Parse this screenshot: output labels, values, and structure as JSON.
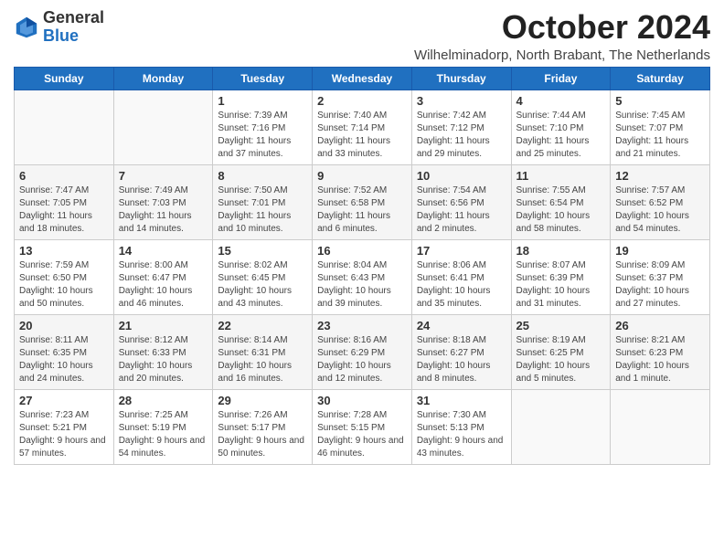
{
  "header": {
    "logo_general": "General",
    "logo_blue": "Blue",
    "month": "October 2024",
    "location": "Wilhelminadorp, North Brabant, The Netherlands"
  },
  "days_of_week": [
    "Sunday",
    "Monday",
    "Tuesday",
    "Wednesday",
    "Thursday",
    "Friday",
    "Saturday"
  ],
  "weeks": [
    [
      {
        "num": "",
        "info": ""
      },
      {
        "num": "",
        "info": ""
      },
      {
        "num": "1",
        "info": "Sunrise: 7:39 AM\nSunset: 7:16 PM\nDaylight: 11 hours and 37 minutes."
      },
      {
        "num": "2",
        "info": "Sunrise: 7:40 AM\nSunset: 7:14 PM\nDaylight: 11 hours and 33 minutes."
      },
      {
        "num": "3",
        "info": "Sunrise: 7:42 AM\nSunset: 7:12 PM\nDaylight: 11 hours and 29 minutes."
      },
      {
        "num": "4",
        "info": "Sunrise: 7:44 AM\nSunset: 7:10 PM\nDaylight: 11 hours and 25 minutes."
      },
      {
        "num": "5",
        "info": "Sunrise: 7:45 AM\nSunset: 7:07 PM\nDaylight: 11 hours and 21 minutes."
      }
    ],
    [
      {
        "num": "6",
        "info": "Sunrise: 7:47 AM\nSunset: 7:05 PM\nDaylight: 11 hours and 18 minutes."
      },
      {
        "num": "7",
        "info": "Sunrise: 7:49 AM\nSunset: 7:03 PM\nDaylight: 11 hours and 14 minutes."
      },
      {
        "num": "8",
        "info": "Sunrise: 7:50 AM\nSunset: 7:01 PM\nDaylight: 11 hours and 10 minutes."
      },
      {
        "num": "9",
        "info": "Sunrise: 7:52 AM\nSunset: 6:58 PM\nDaylight: 11 hours and 6 minutes."
      },
      {
        "num": "10",
        "info": "Sunrise: 7:54 AM\nSunset: 6:56 PM\nDaylight: 11 hours and 2 minutes."
      },
      {
        "num": "11",
        "info": "Sunrise: 7:55 AM\nSunset: 6:54 PM\nDaylight: 10 hours and 58 minutes."
      },
      {
        "num": "12",
        "info": "Sunrise: 7:57 AM\nSunset: 6:52 PM\nDaylight: 10 hours and 54 minutes."
      }
    ],
    [
      {
        "num": "13",
        "info": "Sunrise: 7:59 AM\nSunset: 6:50 PM\nDaylight: 10 hours and 50 minutes."
      },
      {
        "num": "14",
        "info": "Sunrise: 8:00 AM\nSunset: 6:47 PM\nDaylight: 10 hours and 46 minutes."
      },
      {
        "num": "15",
        "info": "Sunrise: 8:02 AM\nSunset: 6:45 PM\nDaylight: 10 hours and 43 minutes."
      },
      {
        "num": "16",
        "info": "Sunrise: 8:04 AM\nSunset: 6:43 PM\nDaylight: 10 hours and 39 minutes."
      },
      {
        "num": "17",
        "info": "Sunrise: 8:06 AM\nSunset: 6:41 PM\nDaylight: 10 hours and 35 minutes."
      },
      {
        "num": "18",
        "info": "Sunrise: 8:07 AM\nSunset: 6:39 PM\nDaylight: 10 hours and 31 minutes."
      },
      {
        "num": "19",
        "info": "Sunrise: 8:09 AM\nSunset: 6:37 PM\nDaylight: 10 hours and 27 minutes."
      }
    ],
    [
      {
        "num": "20",
        "info": "Sunrise: 8:11 AM\nSunset: 6:35 PM\nDaylight: 10 hours and 24 minutes."
      },
      {
        "num": "21",
        "info": "Sunrise: 8:12 AM\nSunset: 6:33 PM\nDaylight: 10 hours and 20 minutes."
      },
      {
        "num": "22",
        "info": "Sunrise: 8:14 AM\nSunset: 6:31 PM\nDaylight: 10 hours and 16 minutes."
      },
      {
        "num": "23",
        "info": "Sunrise: 8:16 AM\nSunset: 6:29 PM\nDaylight: 10 hours and 12 minutes."
      },
      {
        "num": "24",
        "info": "Sunrise: 8:18 AM\nSunset: 6:27 PM\nDaylight: 10 hours and 8 minutes."
      },
      {
        "num": "25",
        "info": "Sunrise: 8:19 AM\nSunset: 6:25 PM\nDaylight: 10 hours and 5 minutes."
      },
      {
        "num": "26",
        "info": "Sunrise: 8:21 AM\nSunset: 6:23 PM\nDaylight: 10 hours and 1 minute."
      }
    ],
    [
      {
        "num": "27",
        "info": "Sunrise: 7:23 AM\nSunset: 5:21 PM\nDaylight: 9 hours and 57 minutes."
      },
      {
        "num": "28",
        "info": "Sunrise: 7:25 AM\nSunset: 5:19 PM\nDaylight: 9 hours and 54 minutes."
      },
      {
        "num": "29",
        "info": "Sunrise: 7:26 AM\nSunset: 5:17 PM\nDaylight: 9 hours and 50 minutes."
      },
      {
        "num": "30",
        "info": "Sunrise: 7:28 AM\nSunset: 5:15 PM\nDaylight: 9 hours and 46 minutes."
      },
      {
        "num": "31",
        "info": "Sunrise: 7:30 AM\nSunset: 5:13 PM\nDaylight: 9 hours and 43 minutes."
      },
      {
        "num": "",
        "info": ""
      },
      {
        "num": "",
        "info": ""
      }
    ]
  ]
}
